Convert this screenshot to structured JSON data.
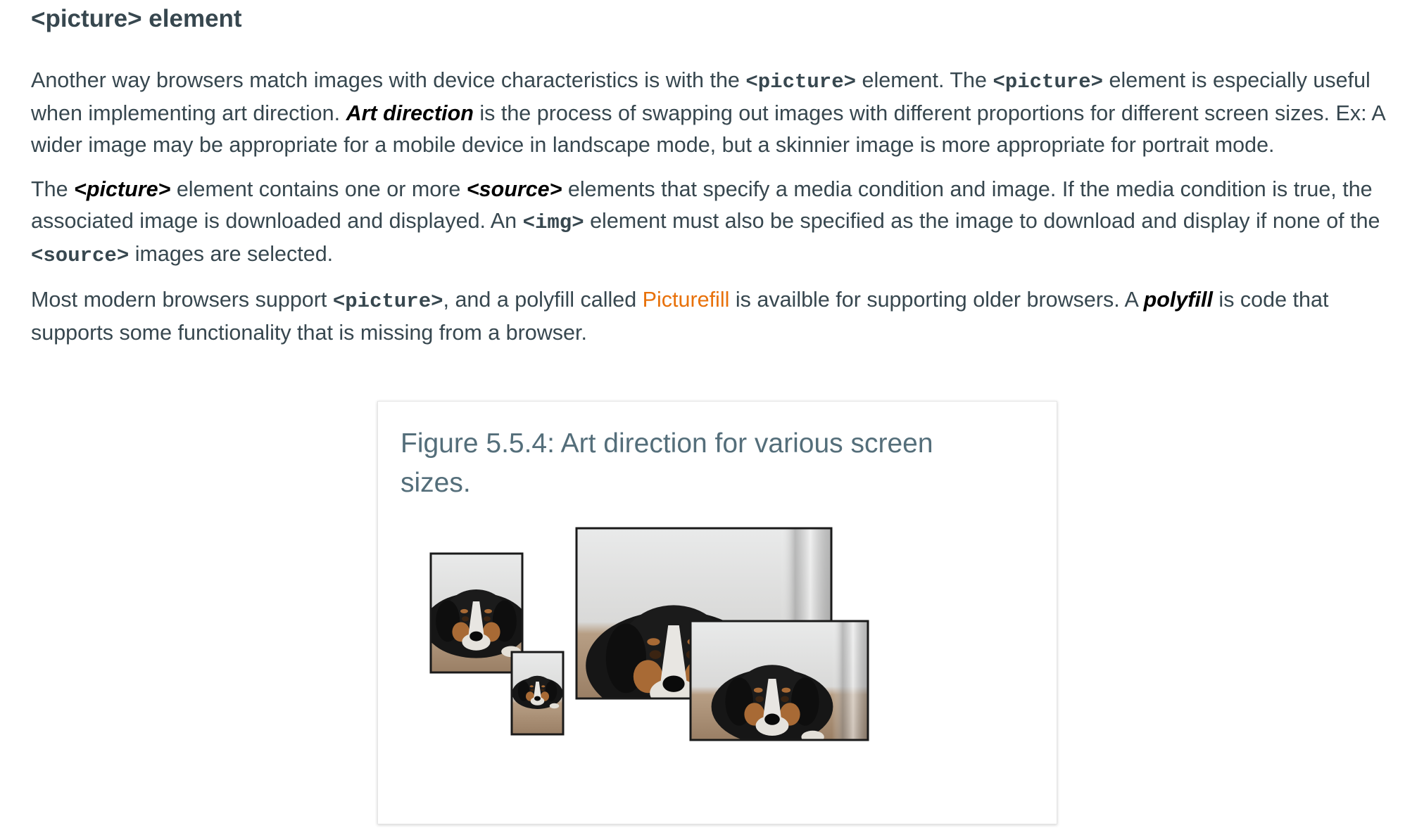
{
  "heading": "<picture> element",
  "paragraph1": {
    "t1": "Another way browsers match images with device characteristics is with the ",
    "code1": "<picture>",
    "t2": " element. The ",
    "code2": "<picture>",
    "t3": " element is especially useful when implementing art direction. ",
    "term": "Art direction",
    "t4": " is the process of swapping out images with different proportions for different screen sizes. Ex: A wider image may be appropriate for a mobile device in landscape mode, but a skinnier image is more appropriate for portrait mode."
  },
  "paragraph2": {
    "t1": "The ",
    "term1": "<picture>",
    "t2": " element contains one or more ",
    "term2": "<source>",
    "t3": " elements that specify a media condition and image. If the media condition is true, the associated image is downloaded and displayed. An ",
    "code1": "<img>",
    "t4": " element must also be specified as the image to download and display if none of the ",
    "code2": "<source>",
    "t5": " images are selected."
  },
  "paragraph3": {
    "t1": "Most modern browsers support ",
    "code1": "<picture>",
    "t2": ", and a polyfill called ",
    "link": "Picturefill",
    "t3": " is availble for supporting older browsers. A ",
    "term": "polyfill",
    "t4": " is code that supports some functionality that is missing from a browser."
  },
  "figure": {
    "caption": "Figure 5.5.4: Art direction for various screen sizes.",
    "image_description_icon": "dog-photo-icon"
  },
  "colors": {
    "text": "#37474f",
    "term": "#000000",
    "link": "#e8710a",
    "caption": "#546e7a"
  }
}
